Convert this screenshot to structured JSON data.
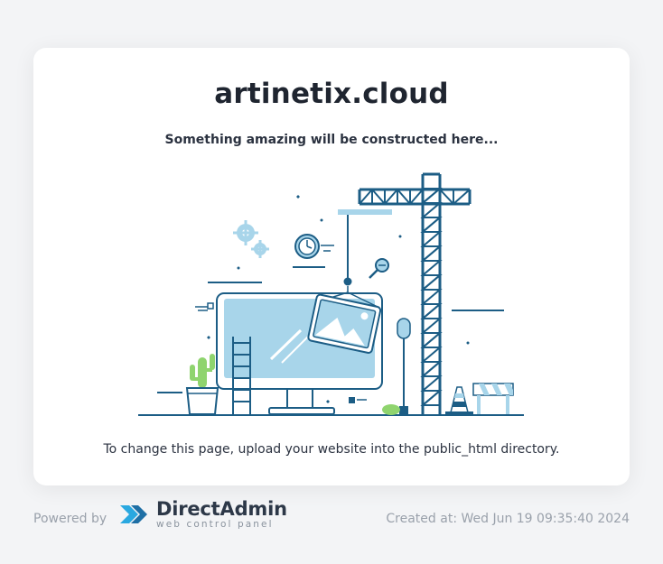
{
  "card": {
    "title": "artinetix.cloud",
    "subtitle": "Something amazing will be constructed here...",
    "instruction": "To change this page, upload your website into the public_html directory."
  },
  "footer": {
    "powered_by": "Powered by",
    "logo_name": "DirectAdmin",
    "logo_tagline": "web control panel",
    "created_at": "Created at: Wed Jun 19 09:35:40 2024"
  },
  "colors": {
    "accent": "#1c5d85",
    "light_blue": "#a8d5ea",
    "logo_blue": "#2aa8e0"
  }
}
